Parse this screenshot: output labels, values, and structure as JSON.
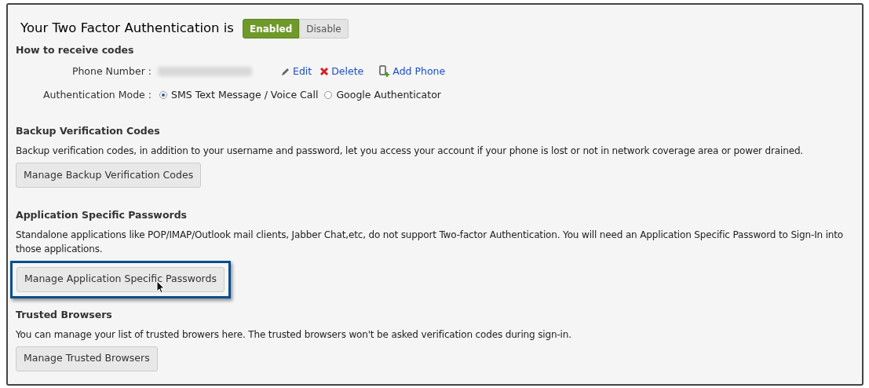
{
  "header": {
    "title": "Your Two Factor Authentication is",
    "toggle": [
      {
        "label": "Enabled",
        "selected": true
      },
      {
        "label": "Disable",
        "selected": false
      }
    ]
  },
  "receive": {
    "heading": "How to receive codes",
    "phone_label": "Phone Number :",
    "phone_actions": [
      {
        "label": "Edit",
        "kind": "edit"
      },
      {
        "label": "Delete",
        "kind": "delete"
      },
      {
        "label": "Add Phone",
        "kind": "add"
      }
    ],
    "mode_label": "Authentication Mode :",
    "modes": [
      {
        "label": "SMS Text Message / Voice Call",
        "selected": true
      },
      {
        "label": "Google Authenticator",
        "selected": false
      }
    ]
  },
  "sections": [
    {
      "heading": "Backup Verification Codes",
      "text": "Backup verification codes, in addition to your username and password, let you access your account if your phone is lost or not in network coverage area or power drained.",
      "button": "Manage Backup Verification Codes",
      "highlighted": false
    },
    {
      "heading": "Application Specific Passwords",
      "text": "Standalone applications like POP/IMAP/Outlook mail clients, Jabber Chat,etc, do not support Two-factor Authentication. You will need an Application Specific Password to Sign-In into those applications.",
      "button": "Manage Application Specific Passwords",
      "highlighted": true
    },
    {
      "heading": "Trusted Browsers",
      "text": "You can manage your list of trusted browers here. The trusted browsers won't be asked verification codes during sign-in.",
      "button": "Manage Trusted Browsers",
      "highlighted": false
    }
  ]
}
